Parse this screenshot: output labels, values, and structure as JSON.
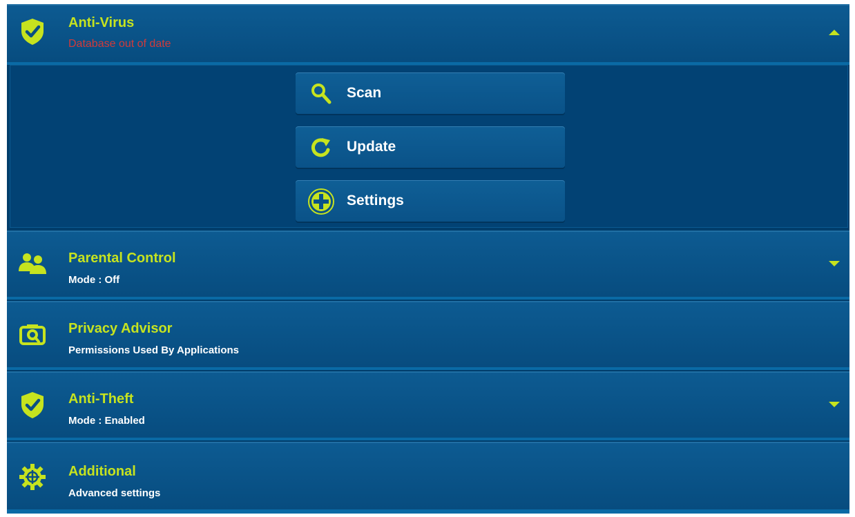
{
  "colors": {
    "accent": "#c6e31f",
    "warning": "#d23a3a",
    "background": "#003d6b",
    "row": "#0a5288"
  },
  "sections": [
    {
      "id": "antivirus",
      "title": "Anti-Virus",
      "subtitle": "Database out of date",
      "icon": "shield-check-icon",
      "state": "expanded"
    },
    {
      "id": "parental",
      "title": "Parental Control",
      "subtitle": "Mode : Off",
      "icon": "people-icon",
      "state": "collapsed"
    },
    {
      "id": "privacy",
      "title": "Privacy Advisor",
      "subtitle": "Permissions Used By Applications",
      "icon": "privacy-lens-icon",
      "state": "none"
    },
    {
      "id": "antitheft",
      "title": "Anti-Theft",
      "subtitle": "Mode : Enabled",
      "icon": "shield-check-icon",
      "state": "collapsed"
    },
    {
      "id": "additional",
      "title": "Additional",
      "subtitle": "Advanced settings",
      "icon": "gear-crosshair-icon",
      "state": "none"
    }
  ],
  "antivirus_actions": [
    {
      "label": "Scan",
      "icon": "magnifier-icon"
    },
    {
      "label": "Update",
      "icon": "refresh-icon"
    },
    {
      "label": "Settings",
      "icon": "plus-circle-icon"
    }
  ]
}
